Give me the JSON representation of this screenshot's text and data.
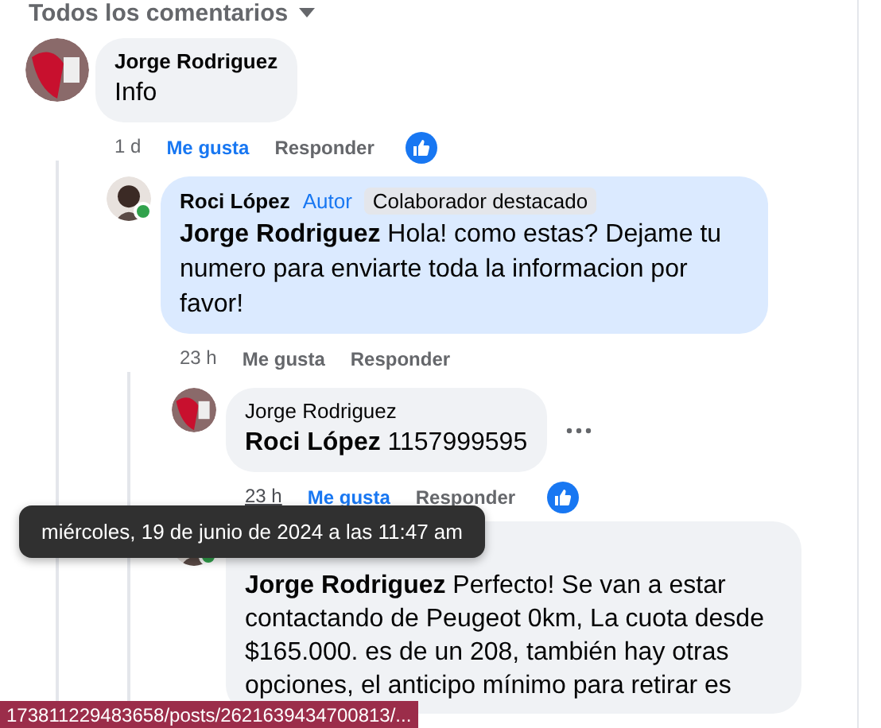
{
  "section_header": {
    "title": "Todos los comentarios"
  },
  "comments": [
    {
      "author": "Jorge Rodriguez",
      "author_bold": true,
      "body": "Info",
      "time": "1 d",
      "time_hovered": false,
      "liked": true,
      "like_label": "Me gusta",
      "reply_label": "Responder",
      "reaction": true,
      "highlighted": false,
      "online": false,
      "more_button": false,
      "children": [
        {
          "author": "Roci López",
          "author_bold": true,
          "badges": [
            {
              "kind": "author",
              "label": "Autor"
            },
            {
              "kind": "chip",
              "label": "Colaborador destacado"
            }
          ],
          "body": "**Jorge Rodriguez** Hola! como estas? Dejame tu numero para enviarte toda la informacion por favor!",
          "time": "23 h",
          "time_hovered": false,
          "liked": false,
          "like_label": "Me gusta",
          "reply_label": "Responder",
          "reaction": false,
          "highlighted": true,
          "online": true,
          "more_button": false,
          "children": [
            {
              "author": "Jorge Rodriguez",
              "author_bold": false,
              "body": "**Roci López** 1157999595",
              "time": "23 h",
              "time_hovered": true,
              "liked": true,
              "like_label": "Me gusta",
              "reply_label": "Responder",
              "reaction": true,
              "highlighted": false,
              "online": false,
              "more_button": true
            },
            {
              "body": "**Jorge Rodriguez** Perfecto! Se van a estar contactando de Peugeot 0km, La cuota desde $165.000. es de un 208, también hay otras opciones, el anticipo mínimo para retirar es",
              "highlighted": false,
              "online": true,
              "more_button": false
            }
          ]
        }
      ]
    }
  ],
  "tooltip": "miércoles, 19 de junio de 2024 a las 11:47 am",
  "status_bar": "173811229483658/posts/2621639434700813/..."
}
